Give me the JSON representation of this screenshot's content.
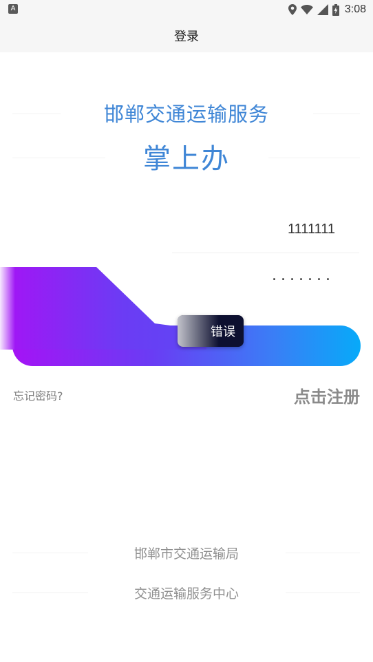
{
  "status_bar": {
    "left_icon_letter": "A",
    "time": "3:08",
    "icons": [
      "location-icon",
      "wifi-icon",
      "signal-icon",
      "battery-charging-icon"
    ]
  },
  "header": {
    "title": "登录"
  },
  "branding": {
    "service_title": "邯郸交通运输服务",
    "app_title": "掌上办"
  },
  "form": {
    "username_value": "1111111",
    "password_mask": ".......",
    "login_button_label": ""
  },
  "toast": {
    "message": "错误"
  },
  "links": {
    "forgot_password": "忘记密码?",
    "register": "点击注册"
  },
  "footer": {
    "line1": "邯郸市交通运输局",
    "line2": "交通运输服务中心"
  },
  "colors": {
    "accent_blue": "#3f86d6",
    "gradient_start": "#a513f5",
    "gradient_end": "#07aaf9",
    "toast_bg": "#0d1030"
  }
}
